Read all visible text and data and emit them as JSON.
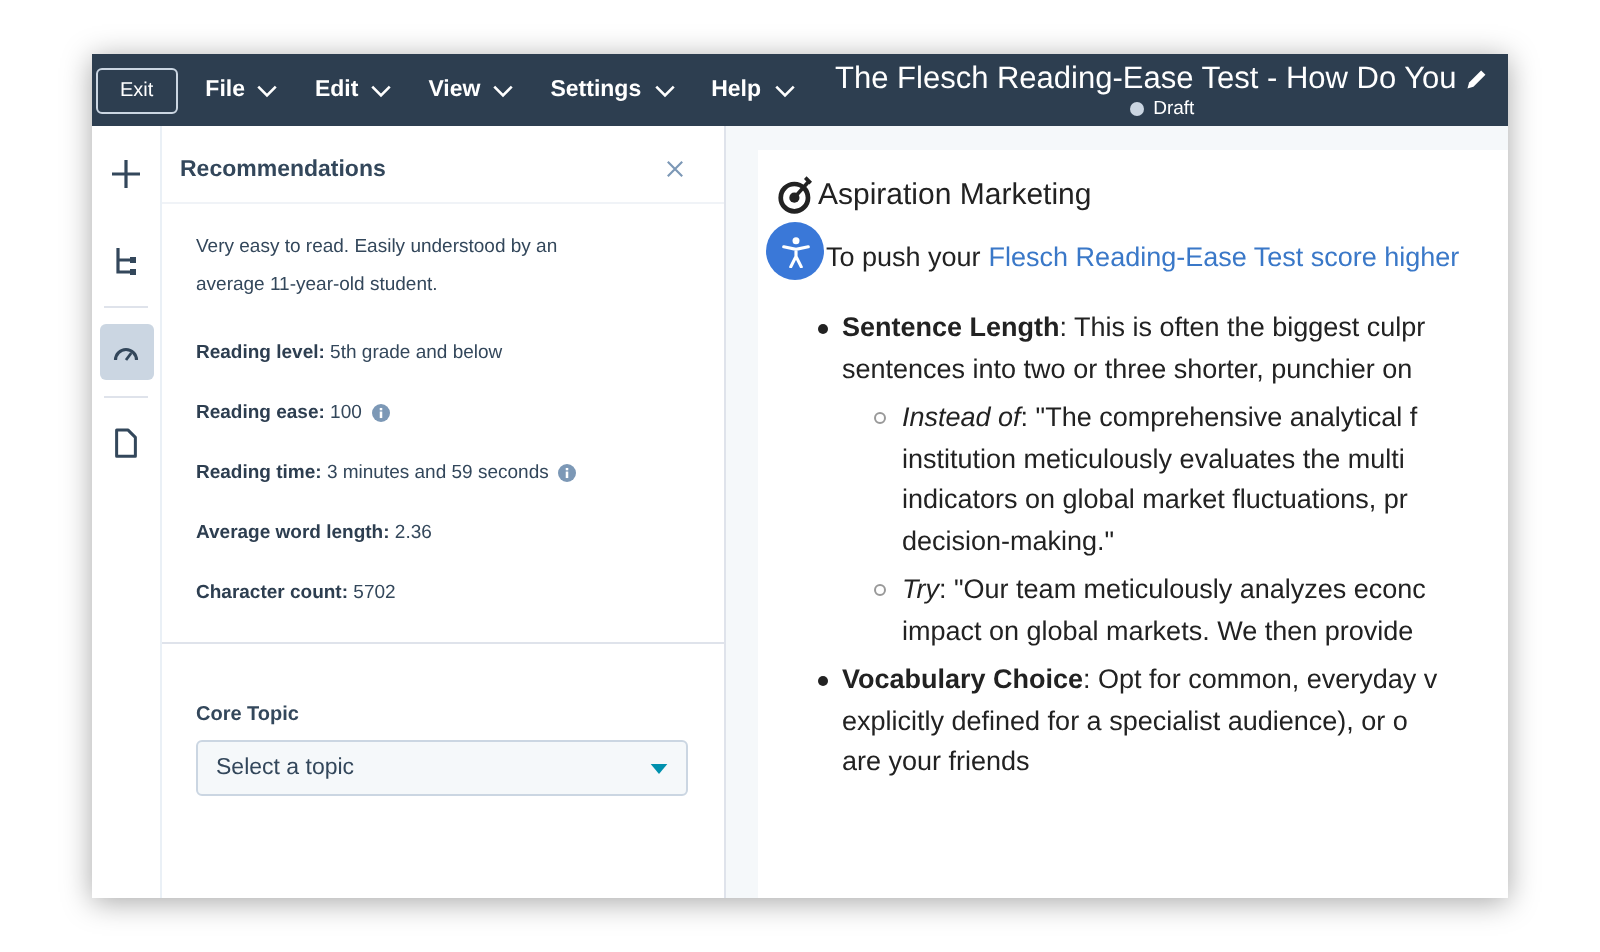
{
  "toolbar": {
    "exit": "Exit",
    "menus": [
      "File",
      "Edit",
      "View",
      "Settings",
      "Help"
    ],
    "title": "The Flesch Reading-Ease Test - How Do You",
    "status": "Draft"
  },
  "rail": [
    {
      "kind": "add",
      "selected": false
    },
    {
      "kind": "structure",
      "selected": false
    },
    {
      "kind": "gauge",
      "selected": true
    },
    {
      "kind": "page",
      "selected": false
    }
  ],
  "panel": {
    "title": "Recommendations",
    "summary": "Very easy to read. Easily understood by an average 11-year-old student.",
    "metrics": [
      {
        "label": "Reading level:",
        "value": "5th grade and below",
        "info": false
      },
      {
        "label": "Reading ease:",
        "value": "100",
        "info": true
      },
      {
        "label": "Reading time:",
        "value": "3 minutes and 59 seconds",
        "info": true
      },
      {
        "label": "Average word length:",
        "value": "2.36",
        "info": false
      },
      {
        "label": "Character count:",
        "value": "5702",
        "info": false
      }
    ],
    "core_topic": {
      "label": "Core Topic",
      "placeholder": "Select a topic"
    }
  },
  "document": {
    "logo": "Aspiration Marketing",
    "intro": "To push your",
    "intro_link": "Flesch Reading-Ease Test score higher",
    "bullets": [
      {
        "lines": [
          "**Sentence Length**: This is often the biggest culpr",
          "sentences into two or three shorter, punchier on"
        ],
        "children": [
          {
            "lines": [
              "*Instead of*: \"The comprehensive analytical f",
              "institution meticulously evaluates the multi",
              "indicators on global market fluctuations, pr",
              "decision-making.\""
            ]
          },
          {
            "lines": [
              "*Try*: \"Our team meticulously analyzes econc",
              "impact on global markets. We then provide"
            ]
          }
        ]
      },
      {
        "lines": [
          "**Vocabulary Choice**: Opt for common, everyday v",
          "explicitly defined for a specialist audience), or o",
          "are your friends"
        ]
      }
    ]
  }
}
